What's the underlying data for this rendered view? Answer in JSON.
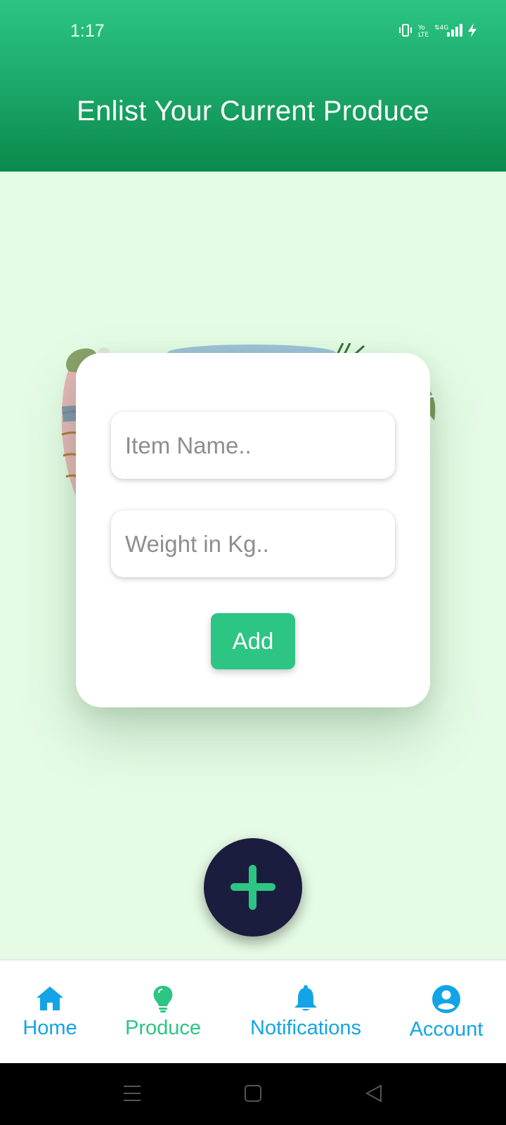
{
  "status_bar": {
    "time": "1:17",
    "icons": [
      "vibrate-icon",
      "volte-icon",
      "4g-icon",
      "signal-icon",
      "charging-icon"
    ]
  },
  "header": {
    "title": "Enlist Your Current Produce",
    "colors": {
      "top": "#2cc583",
      "bottom": "#0a8a4c"
    }
  },
  "form": {
    "item_name": {
      "value": "",
      "placeholder": "Item Name.."
    },
    "weight": {
      "value": "",
      "placeholder": "Weight in Kg.."
    },
    "add_label": "Add"
  },
  "fab": {
    "icon": "plus-icon"
  },
  "bottom_nav": {
    "items": [
      {
        "label": "Home",
        "icon": "home-icon",
        "active": false
      },
      {
        "label": "Produce",
        "icon": "lightbulb-icon",
        "active": true
      },
      {
        "label": "Notifications",
        "icon": "bell-icon",
        "active": false
      },
      {
        "label": "Account",
        "icon": "account-icon",
        "active": false
      }
    ]
  },
  "system_nav": {
    "icons": [
      "menu-icon",
      "home-square-icon",
      "back-icon"
    ]
  },
  "colors": {
    "accent": "#2cc583",
    "nav_blue": "#13a4e8",
    "fab_bg": "#1b1d3f",
    "bg": "#e5fbe5"
  }
}
